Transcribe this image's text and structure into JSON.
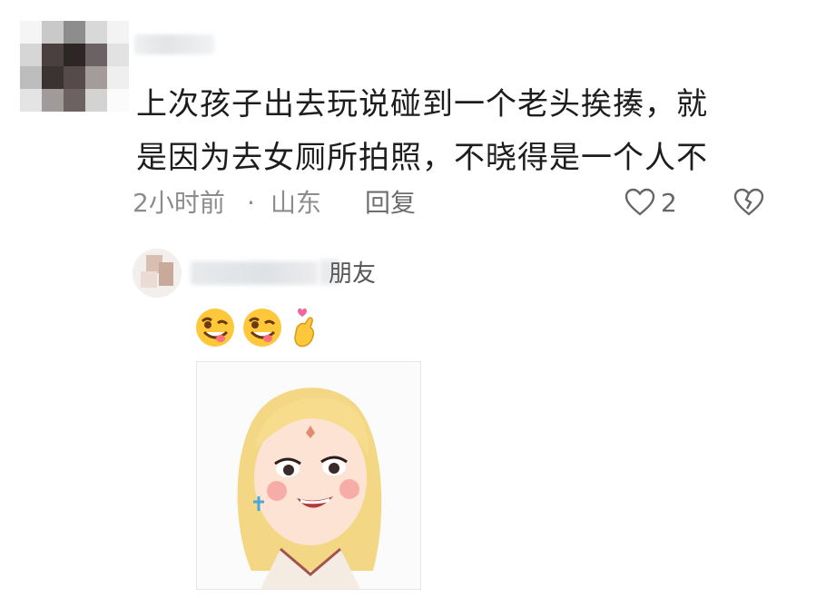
{
  "comment": {
    "text_line1": "上次孩子出去玩说碰到一个老头挨揍，就",
    "text_line2": "是因为去女厕所拍照，不晓得是一个人不",
    "time": "2小时前",
    "separator": "·",
    "location": "山东",
    "reply_label": "回复",
    "like_count": "2",
    "like_icon": "heart-outline-icon",
    "dislike_icon": "broken-heart-icon"
  },
  "reply": {
    "name_suffix": "朋友",
    "emojis": [
      "wink-tongue-face-emoji",
      "wink-tongue-face-emoji",
      "finger-heart-emoji"
    ],
    "sticker": "cartoon-girl-sticker"
  },
  "colors": {
    "meta_gray": "#8c8c8c",
    "text": "#1d1d1d",
    "heart_pink": "#f2679b",
    "emoji_yellow": "#ffc73a"
  }
}
